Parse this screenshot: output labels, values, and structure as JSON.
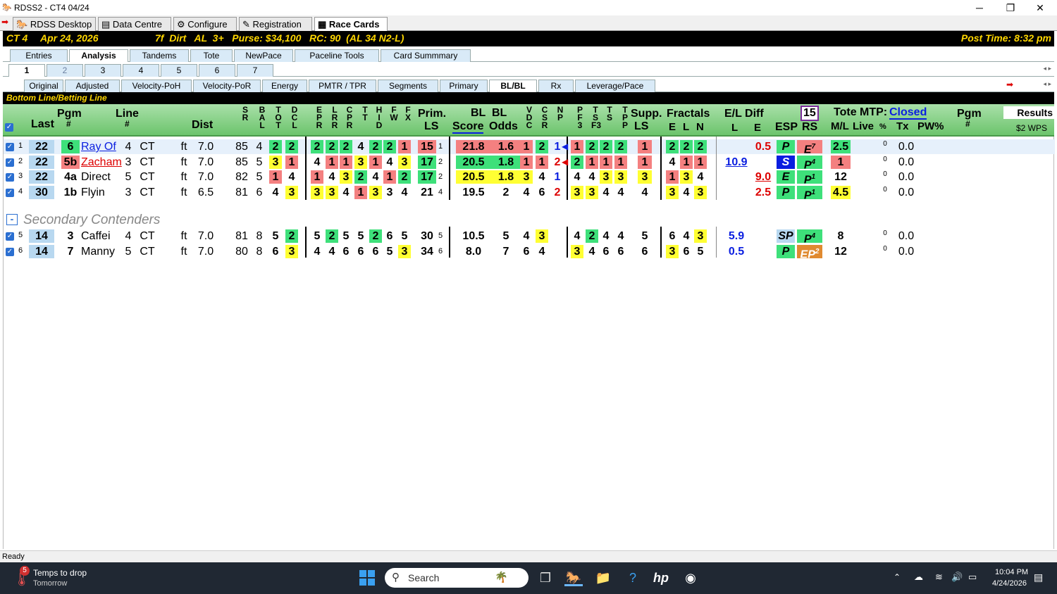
{
  "window": {
    "title": "RDSS2 - CT4  04/24",
    "min": "─",
    "max": "❐",
    "close": "✕"
  },
  "toptabs": [
    "RDSS Desktop",
    "Data Centre",
    "Configure",
    "Registration",
    "Race Cards"
  ],
  "race": {
    "track": "CT  4",
    "date": "Apr 24, 2026",
    "info": "7f  Dirt   AL  3+   Purse: $34,100   RC: 90  (AL 34 N2-L)",
    "post": "Post Time: 8:32 pm"
  },
  "tabs1": [
    "Entries",
    "Analysis",
    "Tandems",
    "Tote",
    "NewPace",
    "Paceline Tools",
    "Card Summmary"
  ],
  "tabs2": [
    "1",
    "2",
    "3",
    "4",
    "5",
    "6",
    "7"
  ],
  "tabs3": [
    "Original",
    "Adjusted",
    "Velocity-PoH",
    "Velocity-PoR",
    "Energy",
    "PMTR / TPR",
    "Segments",
    "Primary",
    "BL/BL",
    "Rx",
    "Leverage/Pace"
  ],
  "section": "Bottom Line/Betting Line",
  "headers": {
    "pgm": "Pgm",
    "pgm_hash": "#",
    "last": "Last",
    "line": "Line",
    "line_hash": "#",
    "dist": "Dist",
    "prim": "Prim.",
    "ls": "LS",
    "bl1": "BL",
    "bl2": "BL",
    "score": "Score",
    "odds": "Odds",
    "supp": "Supp.",
    "supp_ls": "LS",
    "fractals": "Fractals",
    "frac_e": "E",
    "frac_l": "L",
    "frac_n": "N",
    "el": "E/L Diff",
    "el_l": "L",
    "el_e": "E",
    "esp": "ESP",
    "rs": "RS",
    "box15": "15",
    "tote": "Tote MTP:",
    "closed": "Closed",
    "ml": "M/L",
    "live": "Live",
    "pct": "%",
    "tx": "Tx",
    "pw": "PW%",
    "pgm2": "Pgm",
    "pgm2_hash": "#",
    "results": "Results",
    "wps": "$2 WPS"
  },
  "stack_headers": [
    "S\nR",
    "B\nA\nL",
    "T\nO\nT",
    "D\nC\nL",
    "E\nP\nR",
    "L\nR\nR",
    "C\nP\nR",
    "T\nT",
    "H\nI\nD",
    "F\nW",
    "F\nX",
    "V\nD\nC",
    "C\nS\nR",
    "N\nP",
    "P\nF\n3",
    "T\nS\nF3",
    "T\nS",
    "T\nP\nP"
  ],
  "rows": [
    {
      "num": "1",
      "last": "22",
      "pgm": "6",
      "name": "Ray Of",
      "line": "4",
      "trk": "CT",
      "surf": "ft",
      "dist": "7.0",
      "sr": "85",
      "bal": "4",
      "tot": "2",
      "dcl": "2",
      "epr": "2",
      "lrr": "2",
      "cpr": "2",
      "tt": "4",
      "hid": "2",
      "fw": "2",
      "fx": "1",
      "prim": "15",
      "prim_r": "1",
      "score": "21.8",
      "odds": "1.6",
      "vdc": "1",
      "csr": "2",
      "np": "1",
      "pf3": "1",
      "tsf3": "2",
      "ts": "2",
      "tpp": "2",
      "supp": "1",
      "fe": "2",
      "fl": "2",
      "fn": "2",
      "ell": "",
      "ele": "0.5",
      "esp": "P",
      "rs": "E",
      "rs_sup": "7",
      "ml": "2.5",
      "live": "0",
      "tx": "0.0"
    },
    {
      "num": "2",
      "last": "22",
      "pgm": "5b",
      "name": "Zacham",
      "line": "3",
      "trk": "CT",
      "surf": "ft",
      "dist": "7.0",
      "sr": "85",
      "bal": "5",
      "tot": "3",
      "dcl": "1",
      "epr": "4",
      "lrr": "1",
      "cpr": "1",
      "tt": "3",
      "hid": "1",
      "fw": "4",
      "fx": "3",
      "prim": "17",
      "prim_r": "2",
      "score": "20.5",
      "odds": "1.8",
      "vdc": "1",
      "csr": "1",
      "np": "2",
      "pf3": "2",
      "tsf3": "1",
      "ts": "1",
      "tpp": "1",
      "supp": "1",
      "fe": "4",
      "fl": "1",
      "fn": "1",
      "ell": "10.9",
      "ele": "",
      "esp": "S",
      "rs": "P",
      "rs_sup": "4",
      "ml": "1",
      "live": "0",
      "tx": "0.0"
    },
    {
      "num": "3",
      "last": "22",
      "pgm": "4a",
      "name": "Direct",
      "line": "5",
      "trk": "CT",
      "surf": "ft",
      "dist": "7.0",
      "sr": "82",
      "bal": "5",
      "tot": "1",
      "dcl": "4",
      "epr": "1",
      "lrr": "4",
      "cpr": "3",
      "tt": "2",
      "hid": "4",
      "fw": "1",
      "fx": "2",
      "prim": "17",
      "prim_r": "2",
      "score": "20.5",
      "odds": "1.8",
      "vdc": "3",
      "csr": "4",
      "np": "1",
      "pf3": "4",
      "tsf3": "4",
      "ts": "3",
      "tpp": "3",
      "supp": "3",
      "fe": "1",
      "fl": "3",
      "fn": "4",
      "ell": "",
      "ele": "9.0",
      "esp": "E",
      "rs": "P",
      "rs_sup": "1",
      "ml": "12",
      "live": "0",
      "tx": "0.0"
    },
    {
      "num": "4",
      "last": "30",
      "pgm": "1b",
      "name": "Flyin",
      "line": "3",
      "trk": "CT",
      "surf": "ft",
      "dist": "6.5",
      "sr": "81",
      "bal": "6",
      "tot": "4",
      "dcl": "3",
      "epr": "3",
      "lrr": "3",
      "cpr": "4",
      "tt": "1",
      "hid": "3",
      "fw": "3",
      "fx": "4",
      "prim": "21",
      "prim_r": "4",
      "score": "19.5",
      "odds": "2",
      "vdc": "4",
      "csr": "6",
      "np": "2",
      "pf3": "3",
      "tsf3": "3",
      "ts": "4",
      "tpp": "4",
      "supp": "4",
      "fe": "3",
      "fl": "4",
      "fn": "3",
      "ell": "",
      "ele": "2.5",
      "esp": "P",
      "rs": "P",
      "rs_sup": "1",
      "ml": "4.5",
      "live": "0",
      "tx": "0.0"
    },
    {
      "num": "5",
      "last": "14",
      "pgm": "3",
      "name": "Caffei",
      "line": "4",
      "trk": "CT",
      "surf": "ft",
      "dist": "7.0",
      "sr": "81",
      "bal": "8",
      "tot": "5",
      "dcl": "2",
      "epr": "5",
      "lrr": "2",
      "cpr": "5",
      "tt": "5",
      "hid": "2",
      "fw": "6",
      "fx": "5",
      "prim": "30",
      "prim_r": "5",
      "score": "10.5",
      "odds": "5",
      "vdc": "4",
      "csr": "3",
      "np": "",
      "pf3": "4",
      "tsf3": "2",
      "ts": "4",
      "tpp": "4",
      "supp": "5",
      "fe": "6",
      "fl": "4",
      "fn": "3",
      "ell": "5.9",
      "ele": "",
      "esp": "SP",
      "rs": "P",
      "rs_sup": "4",
      "ml": "8",
      "live": "0",
      "tx": "0.0"
    },
    {
      "num": "6",
      "last": "14",
      "pgm": "7",
      "name": "Manny",
      "line": "5",
      "trk": "CT",
      "surf": "ft",
      "dist": "7.0",
      "sr": "80",
      "bal": "8",
      "tot": "6",
      "dcl": "3",
      "epr": "4",
      "lrr": "4",
      "cpr": "6",
      "tt": "6",
      "hid": "6",
      "fw": "5",
      "fx": "3",
      "prim": "34",
      "prim_r": "6",
      "score": "8.0",
      "odds": "7",
      "vdc": "6",
      "csr": "4",
      "np": "",
      "pf3": "3",
      "tsf3": "4",
      "ts": "6",
      "tpp": "6",
      "supp": "6",
      "fe": "3",
      "fl": "6",
      "fn": "5",
      "ell": "0.5",
      "ele": "",
      "esp": "P",
      "rs": "EP",
      "rs_sup": "2",
      "ml": "12",
      "live": "0",
      "tx": "0.0"
    }
  ],
  "secondary_label": "Secondary Contenders",
  "collapse": "-",
  "status": "Ready",
  "taskbar": {
    "weather_title": "Temps to drop",
    "weather_sub": "Tomorrow",
    "badge": "5",
    "search": "Search",
    "time": "10:04 PM",
    "date": "4/24/2026"
  },
  "colors": {
    "green": "#3ee07a",
    "yellow": "#ffff33",
    "red": "#f48080",
    "header": "#6cc46c"
  }
}
